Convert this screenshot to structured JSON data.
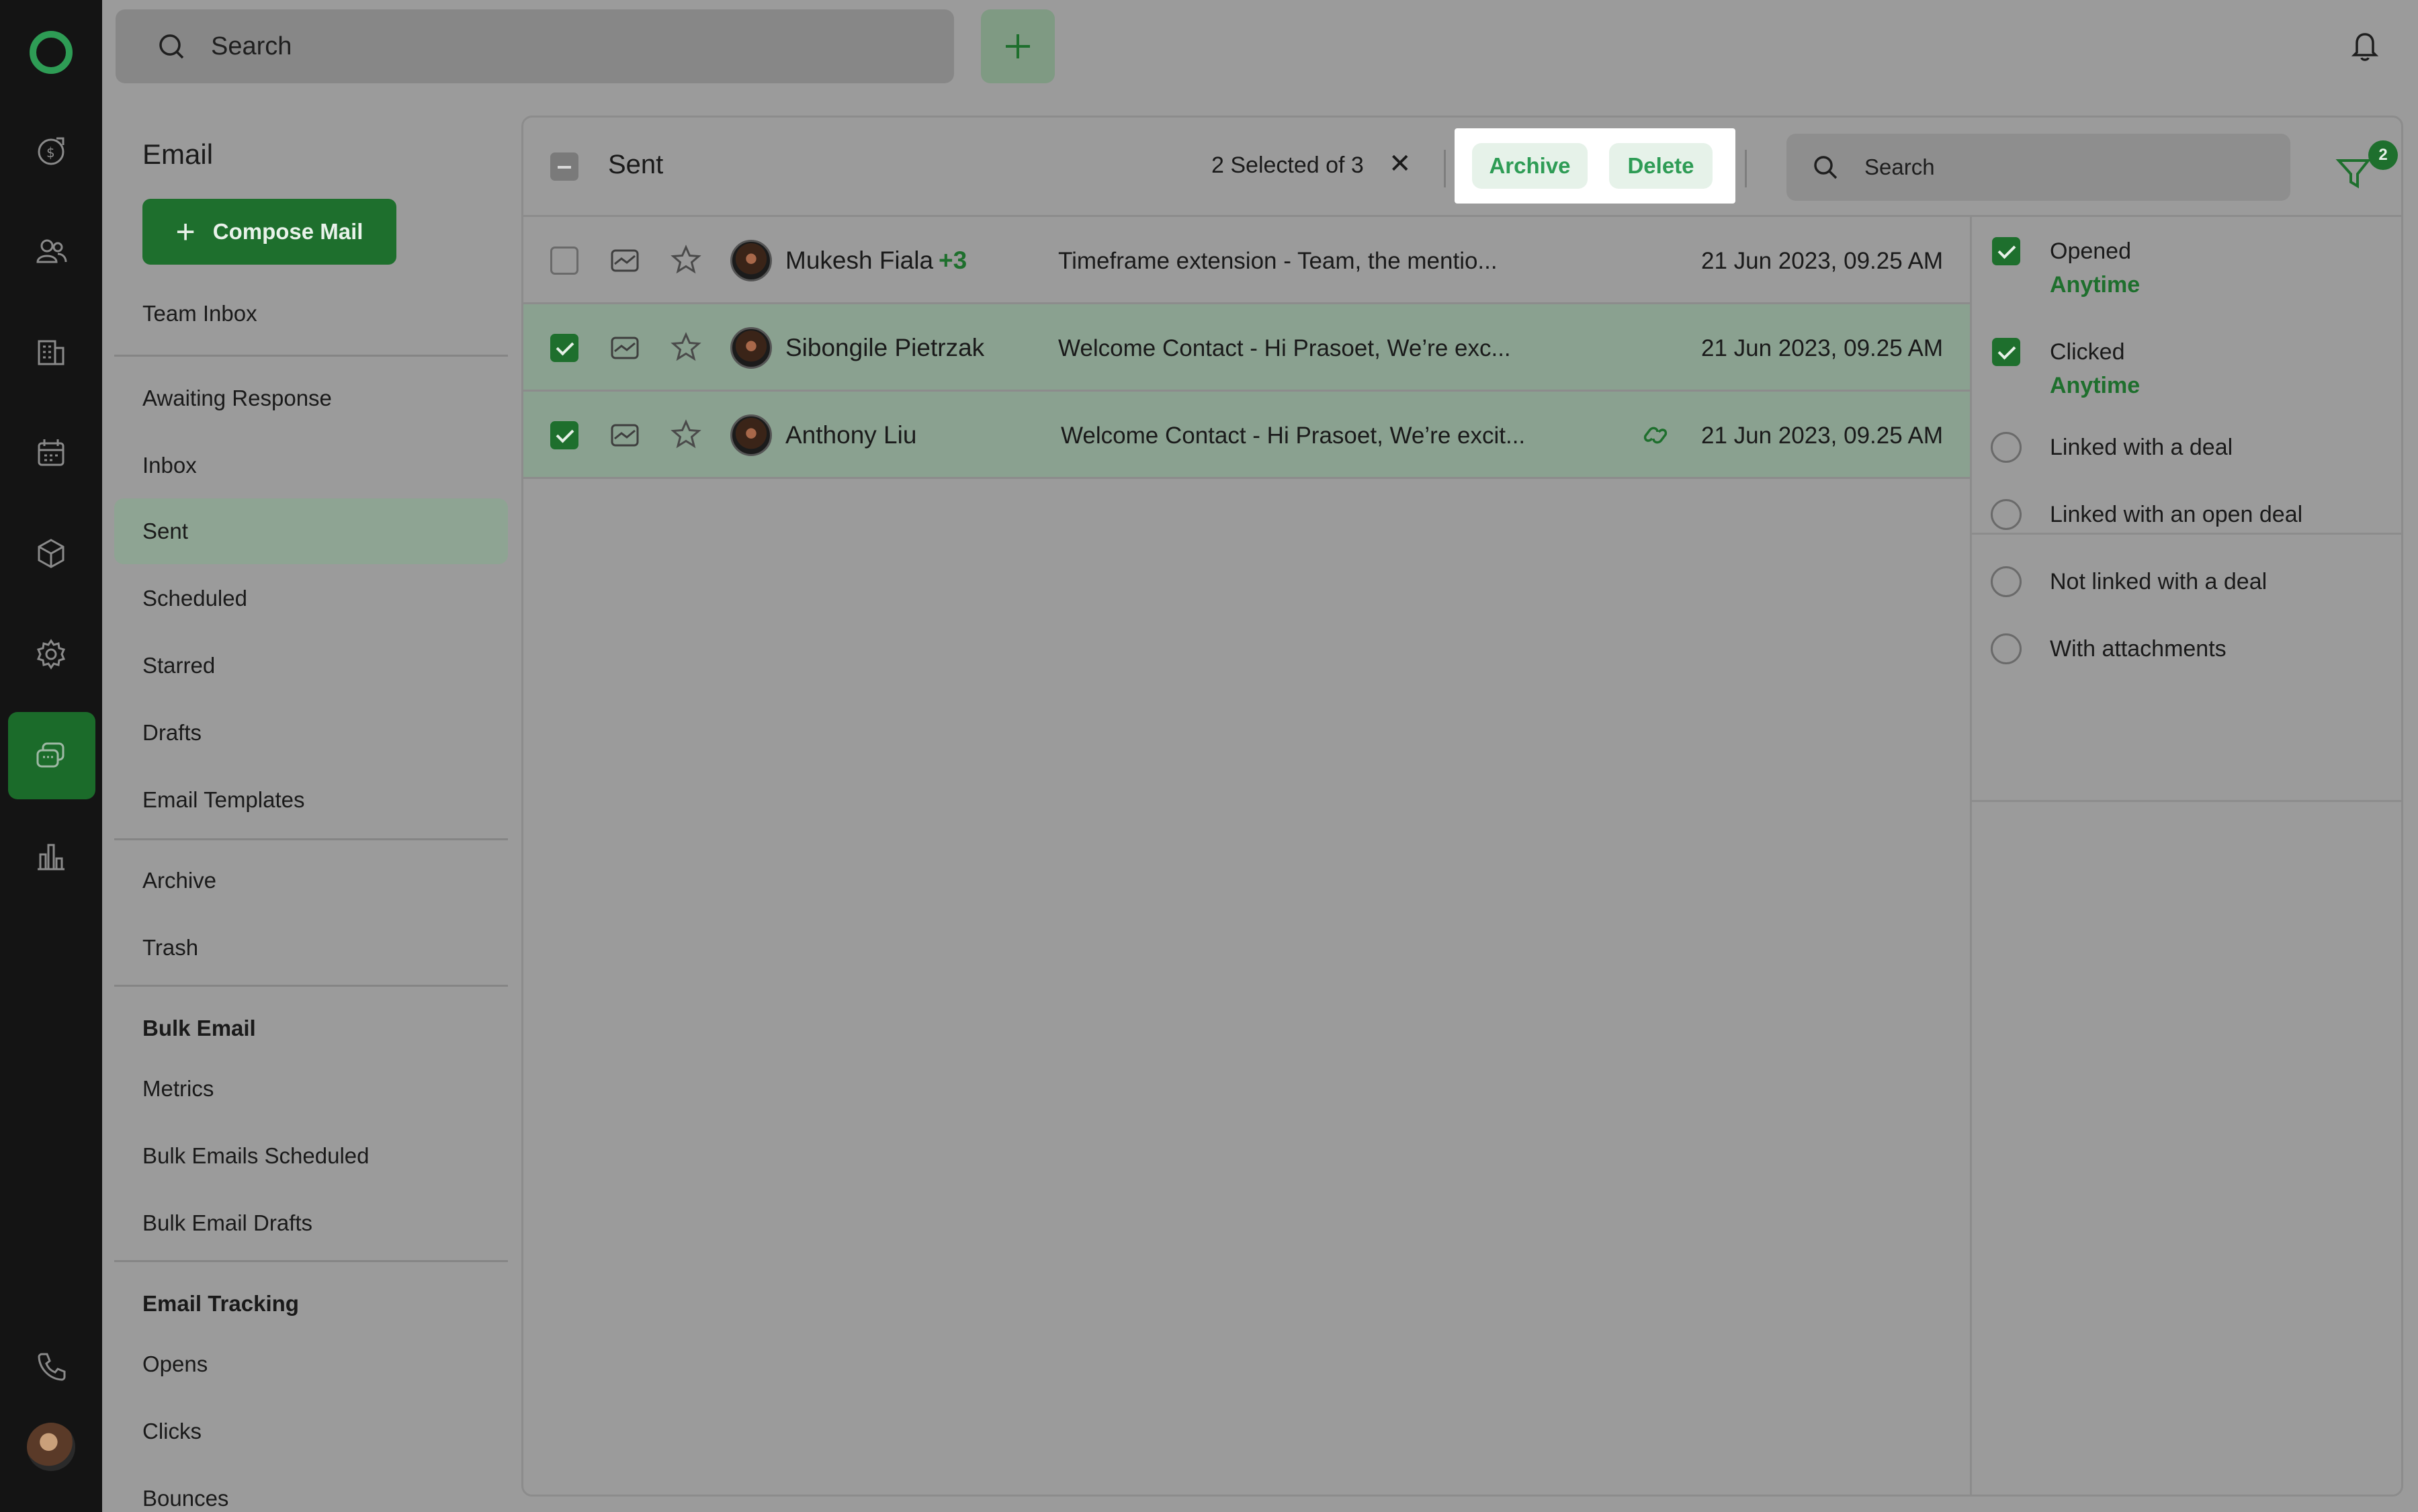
{
  "topbar": {
    "search_placeholder": "Search"
  },
  "nav": {
    "title": "Email",
    "compose_label": "Compose Mail",
    "items": [
      {
        "label": "Team Inbox"
      },
      {
        "label": "Awaiting Response"
      },
      {
        "label": "Inbox"
      },
      {
        "label": "Sent"
      },
      {
        "label": "Scheduled"
      },
      {
        "label": "Starred"
      },
      {
        "label": "Drafts"
      },
      {
        "label": "Email Templates"
      },
      {
        "label": "Archive"
      },
      {
        "label": "Trash"
      },
      {
        "label": "Bulk Email"
      },
      {
        "label": "Metrics"
      },
      {
        "label": "Bulk Emails Scheduled"
      },
      {
        "label": "Bulk Email Drafts"
      },
      {
        "label": "Email Tracking"
      },
      {
        "label": "Opens"
      },
      {
        "label": "Clicks"
      },
      {
        "label": "Bounces"
      }
    ],
    "active": "Sent"
  },
  "panel": {
    "title": "Sent",
    "selected_count": "2 Selected of 3",
    "clear": "✕",
    "archive_label": "Archive",
    "delete_label": "Delete",
    "search_placeholder": "Search",
    "filter_badge": "2"
  },
  "emails": [
    {
      "name": "Mukesh Fiala",
      "extra": "+3",
      "subject": "Timeframe extension  -  Team, the mentio...",
      "date": "21 Jun 2023, 09.25 AM",
      "selected": false
    },
    {
      "name": "Sibongile Pietrzak",
      "extra": "",
      "subject": "Welcome Contact  -  Hi Prasoet, We’re exc...",
      "date": "21 Jun 2023, 09.25 AM",
      "selected": true
    },
    {
      "name": "Anthony Liu",
      "extra": "",
      "subject": "Welcome Contact  -  Hi Prasoet, We’re excit...",
      "date": "21 Jun 2023, 09.25 AM",
      "selected": true
    }
  ],
  "filters": {
    "opened": {
      "label": "Opened",
      "sub": "Anytime",
      "checked": true
    },
    "clicked": {
      "label": "Clicked",
      "sub": "Anytime",
      "checked": true
    },
    "options": [
      {
        "label": "Linked with a deal"
      },
      {
        "label": "Linked with an open deal"
      },
      {
        "label": "Not linked with a deal"
      },
      {
        "label": "With attachments"
      }
    ]
  },
  "colors": {
    "accent": "#1e6f2d",
    "accent_light": "#2e9c55",
    "rail": "#141414"
  }
}
